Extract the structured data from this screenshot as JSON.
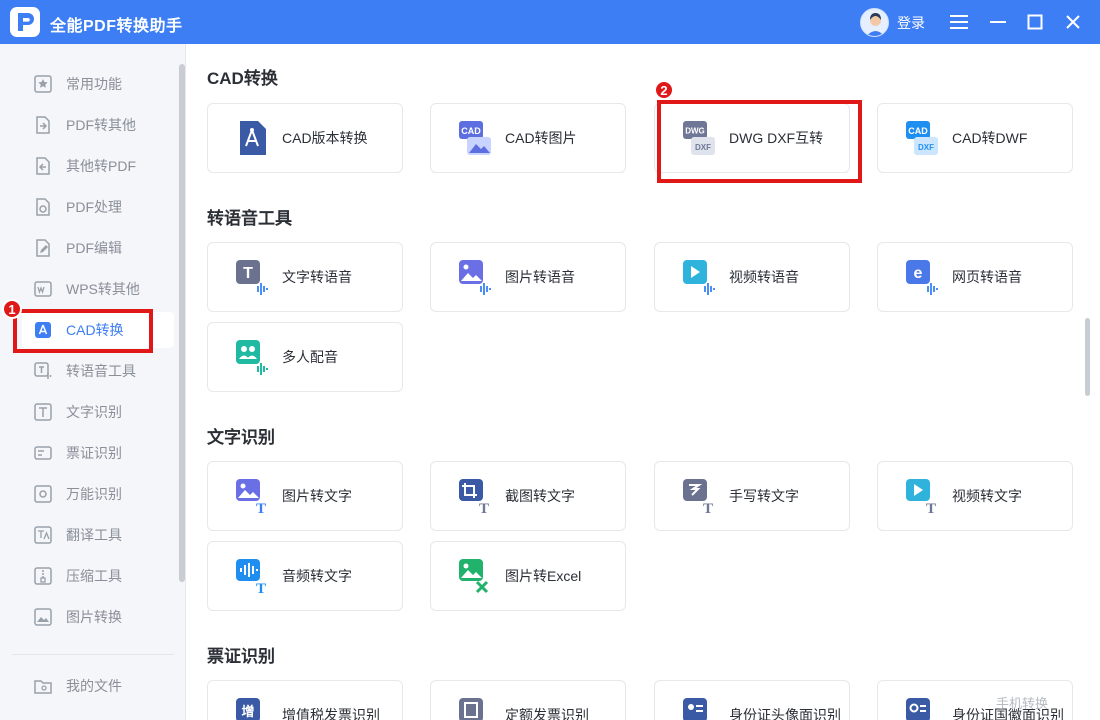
{
  "app": {
    "title": "全能PDF转换助手",
    "login": "登录"
  },
  "colors": {
    "accent": "#3d7ef4",
    "annotation": "#e01818"
  },
  "sidebar": {
    "items": [
      {
        "label": "常用功能",
        "icon": "star-grid-icon"
      },
      {
        "label": "PDF转其他",
        "icon": "pdf-export-icon"
      },
      {
        "label": "其他转PDF",
        "icon": "pdf-import-icon"
      },
      {
        "label": "PDF处理",
        "icon": "pdf-process-icon"
      },
      {
        "label": "PDF编辑",
        "icon": "pdf-edit-icon"
      },
      {
        "label": "WPS转其他",
        "icon": "wps-icon"
      },
      {
        "label": "CAD转换",
        "icon": "cad-icon",
        "active": true
      },
      {
        "label": "转语音工具",
        "icon": "speech-icon"
      },
      {
        "label": "文字识别",
        "icon": "text-ocr-icon"
      },
      {
        "label": "票证识别",
        "icon": "ticket-icon"
      },
      {
        "label": "万能识别",
        "icon": "scan-eye-icon"
      },
      {
        "label": "翻译工具",
        "icon": "translate-icon"
      },
      {
        "label": "压缩工具",
        "icon": "zip-icon"
      },
      {
        "label": "图片转换",
        "icon": "image-convert-icon"
      }
    ],
    "my_files": "我的文件"
  },
  "sections": [
    {
      "title": "CAD转换",
      "cards": [
        "CAD版本转换",
        "CAD转图片",
        "DWG DXF互转",
        "CAD转DWF"
      ]
    },
    {
      "title": "转语音工具",
      "cards": [
        "文字转语音",
        "图片转语音",
        "视频转语音",
        "网页转语音",
        "多人配音"
      ]
    },
    {
      "title": "文字识别",
      "cards": [
        "图片转文字",
        "截图转文字",
        "手写转文字",
        "视频转文字",
        "音频转文字",
        "图片转Excel"
      ]
    },
    {
      "title": "票证识别",
      "cards": [
        "增值税发票识别",
        "定额发票识别",
        "身份证头像面识别",
        "身份证国徽面识别"
      ]
    }
  ],
  "icon_text": {
    "cad": "CAD",
    "dwg": "DWG",
    "dxf": "DXF",
    "t": "T",
    "zeng": "增",
    "e": "e"
  },
  "annotations": {
    "badge1": "1",
    "badge2": "2"
  },
  "watermark": "手机转换"
}
